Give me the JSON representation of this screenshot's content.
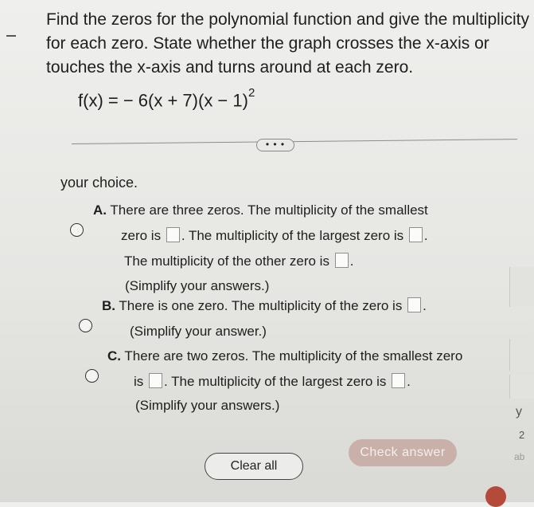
{
  "question": {
    "lines": [
      "Find the zeros for the polynomial function and give the multiplicity",
      "for each zero. State whether the graph crosses the x-axis or",
      "touches the x-axis and turns around at each zero."
    ],
    "formula_base": "f(x) = − 6(x + 7)(x − 1)",
    "formula_exponent": "2"
  },
  "more_button": "• • •",
  "choice_prompt": "your choice.",
  "options": {
    "a": {
      "letter": "A.",
      "l1": "There are three zeros. The multiplicity of the smallest",
      "l2a": "zero is",
      "l2b": ". The multiplicity of the largest zero is",
      "l2c": ".",
      "l3a": "The multiplicity of the other zero is",
      "l3b": ".",
      "l4": "(Simplify your answers.)"
    },
    "b": {
      "letter": "B.",
      "l1a": "There is one zero. The multiplicity of the zero is",
      "l1b": ".",
      "l2": "(Simplify your answer.)"
    },
    "c": {
      "letter": "C.",
      "l1": "There are two zeros. The multiplicity of the smallest zero",
      "l2a": "is",
      "l2b": ". The multiplicity of the largest zero is",
      "l2c": ".",
      "l3": "(Simplify your answers.)"
    }
  },
  "buttons": {
    "clear": "Clear all",
    "check": "Check answer"
  },
  "margin": {
    "g1": "y",
    "g2": "2",
    "g3": "ab"
  }
}
